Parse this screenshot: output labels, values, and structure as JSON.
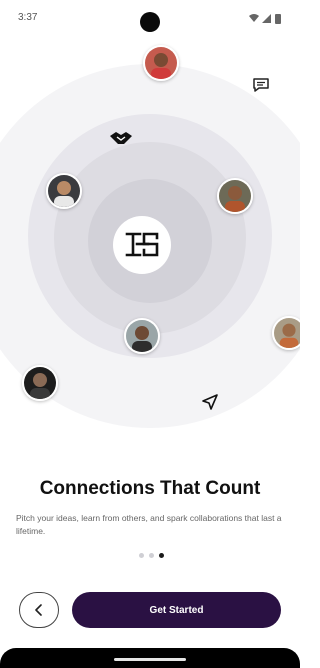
{
  "status_bar": {
    "time": "3:37",
    "icons": [
      "wifi-icon",
      "signal-icon",
      "battery-icon"
    ]
  },
  "hero": {
    "center_icon": "brand-logo-icon",
    "floating_icons": [
      "handshake-icon",
      "chat-icon",
      "send-icon"
    ],
    "avatars": [
      "avatar-1",
      "avatar-2",
      "avatar-3",
      "avatar-4",
      "avatar-5",
      "avatar-6"
    ]
  },
  "content": {
    "title": "Connections That Count",
    "subtitle": "Pitch your ideas, learn from others, and spark collaborations that last a lifetime."
  },
  "pagination": {
    "total": 3,
    "active_index": 2
  },
  "actions": {
    "back_icon": "chevron-left-icon",
    "primary_label": "Get Started"
  },
  "colors": {
    "primary": "#2a1143",
    "ring_light": "#f4f4f6",
    "ring_dark": "#d2d1d8"
  }
}
